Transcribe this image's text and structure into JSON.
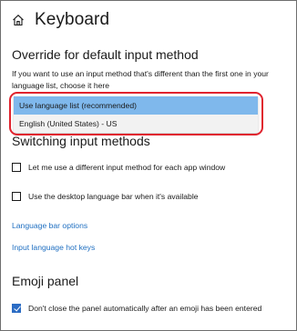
{
  "header": {
    "title": "Keyboard",
    "home_icon": "home-icon"
  },
  "override_section": {
    "title": "Override for default input method",
    "description": "If you want to use an input method that's different than the first one in your language list, choose it here",
    "dropdown": {
      "options": [
        {
          "label": "Use language list (recommended)",
          "selected": true
        },
        {
          "label": "English (United States) - US",
          "selected": false
        }
      ]
    }
  },
  "switching_section": {
    "title": "Switching input methods",
    "checkboxes": [
      {
        "label": "Let me use a different input method for each app window",
        "checked": false
      },
      {
        "label": "Use the desktop language bar when it's available",
        "checked": false
      }
    ],
    "links": [
      "Language bar options",
      "Input language hot keys"
    ]
  },
  "emoji_section": {
    "title": "Emoji panel",
    "checkbox": {
      "label": "Don't close the panel automatically after an emoji has been entered",
      "checked": true
    }
  },
  "colors": {
    "highlight_outline": "#e0232e",
    "selected_option": "#7fb8ec",
    "link": "#1f6fc1",
    "checkbox_checked": "#2b6cc4"
  }
}
